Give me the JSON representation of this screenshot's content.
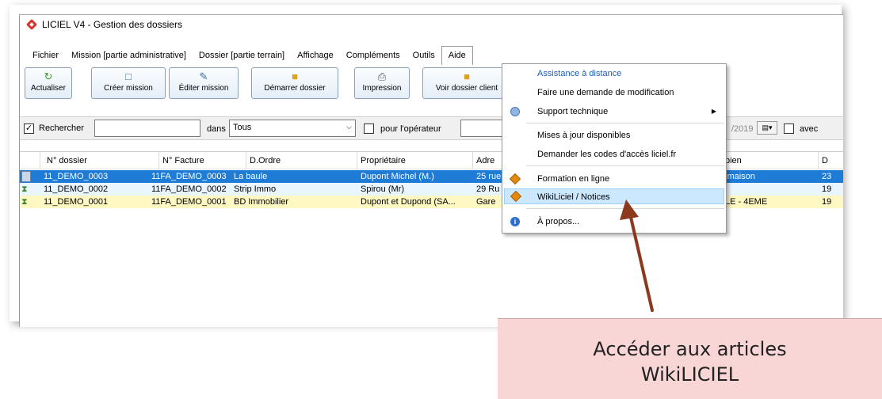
{
  "window": {
    "title": "LICIEL V4 - Gestion des dossiers"
  },
  "menubar": {
    "items": [
      "Fichier",
      "Mission [partie administrative]",
      "Dossier [partie terrain]",
      "Affichage",
      "Compléments",
      "Outils",
      "Aide"
    ]
  },
  "toolbar": {
    "buttons": [
      {
        "label": "Actualiser",
        "icon": "refresh-icon"
      },
      {
        "label": "Créer mission",
        "icon": "new-document-icon"
      },
      {
        "label": "Éditer mission",
        "icon": "edit-document-icon"
      },
      {
        "label": "Démarrer dossier",
        "icon": "folder-icon"
      },
      {
        "label": "Impression",
        "icon": "printer-icon"
      },
      {
        "label": "Voir dossier client",
        "icon": "client-folder-icon"
      }
    ]
  },
  "search": {
    "checkbox_label": "Rechercher",
    "dans_label": "dans",
    "scope_value": "Tous",
    "operator_label": "pour l'opérateur",
    "date_value": "/2019",
    "avec_label": "avec"
  },
  "grid": {
    "columns": [
      "N° dossier",
      "N° Facture",
      "D.Ordre",
      "Propriétaire",
      "Adre",
      "bien",
      "D"
    ],
    "rows": [
      {
        "dossier": "11_DEMO_0003",
        "facture": "11FA_DEMO_0003",
        "ordre": "La baule",
        "proprietaire": "Dupont Michel (M.)",
        "adresse": "25 rue",
        "bien": "lmaison",
        "d": "23",
        "selected": true
      },
      {
        "dossier": "11_DEMO_0002",
        "facture": "11FA_DEMO_0002",
        "ordre": "Strip Immo",
        "proprietaire": "Spirou (Mr)",
        "adresse": "29 Ru",
        "bien": "",
        "d": "19"
      },
      {
        "dossier": "11_DEMO_0001",
        "facture": "11FA_DEMO_0001",
        "ordre": "BD Immobilier",
        "proprietaire": "Dupont et Dupond (SA...",
        "adresse": "Gare",
        "bien": "LE - 4EME",
        "d": "19"
      }
    ]
  },
  "aide_menu": {
    "items": [
      {
        "label": "Assistance à distance",
        "link": true
      },
      {
        "label": "Faire une demande de modification"
      },
      {
        "label": "Support technique",
        "icon": "support-icon",
        "submenu": true
      },
      {
        "label": "Mises à jour disponibles"
      },
      {
        "label": "Demander les codes d'accès liciel.fr"
      },
      {
        "label": "Formation en ligne",
        "icon": "liciel-diamond-icon"
      },
      {
        "label": "WikiLiciel / Notices",
        "icon": "liciel-diamond-icon",
        "highlighted": true
      },
      {
        "label": "À propos...",
        "icon": "info-icon"
      }
    ]
  },
  "callout": {
    "line1": "Accéder aux articles",
    "line2": "WikiLICIEL"
  },
  "colors": {
    "selection": "#1e7bd6",
    "highlight": "#cce8ff",
    "callout_bg": "#f8d6d6",
    "arrow": "#8b3a1e"
  }
}
